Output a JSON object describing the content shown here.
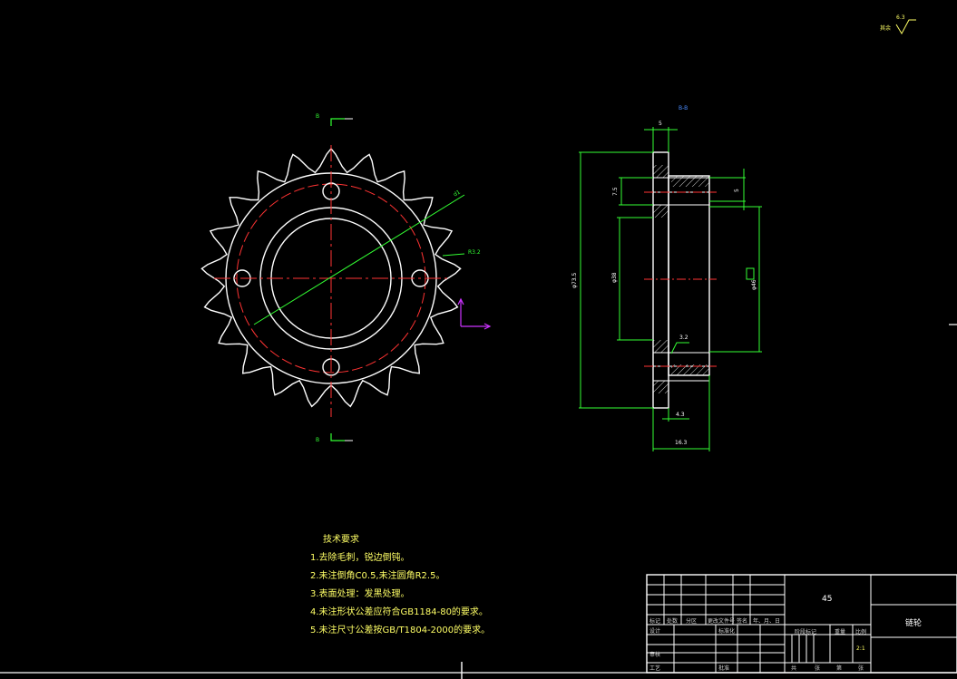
{
  "roughness": {
    "label": "其余",
    "value": "6.3"
  },
  "front_view": {
    "section_mark_top": "B",
    "section_mark_bottom": "B",
    "dim_d1": "d1",
    "dim_r": "R3.2"
  },
  "section_view": {
    "title": "B-B",
    "dims": {
      "top_width": "5",
      "d_outer": "φ73.5",
      "d_bore": "φ38",
      "d_hub": "φ46",
      "side_left": "7.5",
      "side_right": "5",
      "bottom_small": "4.3",
      "bottom_total": "16.3",
      "surface": "3.2"
    }
  },
  "tech_notes": {
    "title": "技术要求",
    "items": [
      "1.去除毛刺，锐边倒钝。",
      "2.未注倒角C0.5,未注圆角R2.5。",
      "3.表面处理：发黑处理。",
      "4.未注形状公差应符合GB1184-80的要求。",
      "5.未注尺寸公差按GB/T1804-2000的要求。"
    ]
  },
  "title_block": {
    "material": "45",
    "part_name": "链轮",
    "scale": "2:1",
    "headers": [
      "标记",
      "处数",
      "分区",
      "更改文件号",
      "签名",
      "年、月、日"
    ],
    "row_design": [
      "设计",
      "标准化"
    ],
    "row_review": "审核",
    "row_process": [
      "工艺",
      "批准"
    ],
    "stage_labels": [
      "阶段标记",
      "重量",
      "比例"
    ],
    "sheet_labels": [
      "共",
      "张",
      "第",
      "张"
    ]
  },
  "colors": {
    "white": "#ffffff",
    "red": "#ff3333",
    "green": "#33ff33",
    "yellow": "#ffff66",
    "magenta": "#cc33ff",
    "blue": "#4a8cff"
  }
}
